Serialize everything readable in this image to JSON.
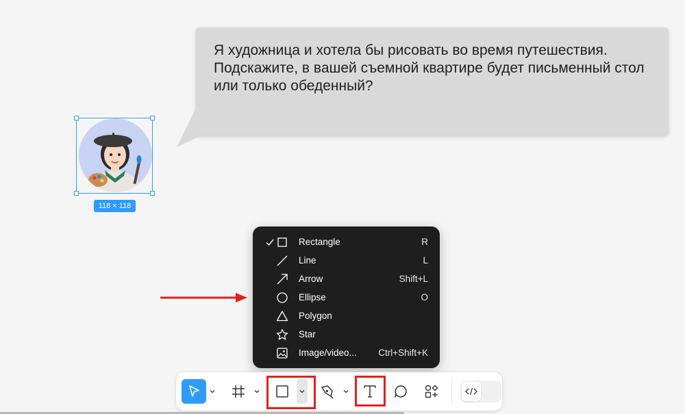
{
  "bubble": {
    "text": "Я художница и хотела бы рисовать во время путешествия. Подскажите, в вашей съемной квартире будет письменный стол или только обеденный?"
  },
  "selection": {
    "size_label": "118 × 118"
  },
  "shape_menu": {
    "items": [
      {
        "label": "Rectangle",
        "shortcut": "R",
        "icon": "rectangle-icon",
        "checked": true
      },
      {
        "label": "Line",
        "shortcut": "L",
        "icon": "line-icon",
        "checked": false
      },
      {
        "label": "Arrow",
        "shortcut": "Shift+L",
        "icon": "arrow-icon",
        "checked": false
      },
      {
        "label": "Ellipse",
        "shortcut": "O",
        "icon": "ellipse-icon",
        "checked": false
      },
      {
        "label": "Polygon",
        "shortcut": "",
        "icon": "polygon-icon",
        "checked": false
      },
      {
        "label": "Star",
        "shortcut": "",
        "icon": "star-icon",
        "checked": false
      },
      {
        "label": "Image/video...",
        "shortcut": "Ctrl+Shift+K",
        "icon": "image-icon",
        "checked": false
      }
    ]
  },
  "toolbar": {
    "tools": [
      "move-tool",
      "frame-tool",
      "shape-tool",
      "pen-tool",
      "text-tool",
      "comment-tool",
      "actions-tool",
      "dev-mode-toggle"
    ],
    "active_tool": "move-tool",
    "highlighted_tools": [
      "shape-tool",
      "text-tool"
    ]
  },
  "colors": {
    "accent": "#2f9bff",
    "highlight": "#e41f1f",
    "menu_bg": "#1e1e1e",
    "bubble_bg": "#d9d9d9"
  }
}
